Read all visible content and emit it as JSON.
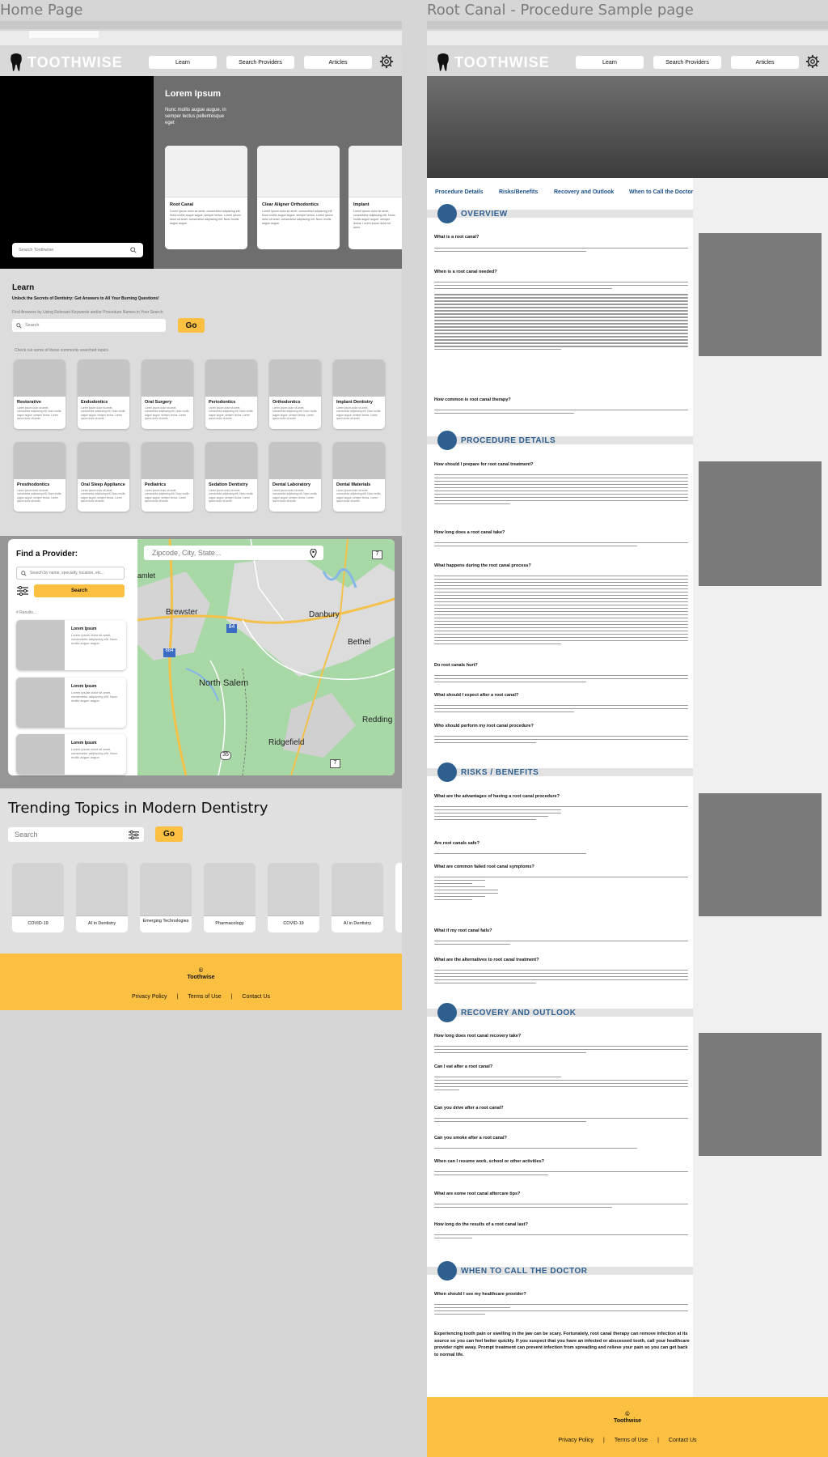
{
  "frames": {
    "home_title": "Home Page",
    "rc_title": "Root Canal - Procedure Sample page"
  },
  "brand": "TOOTHWISE",
  "nav": [
    "Learn",
    "Search Providers",
    "Articles"
  ],
  "home": {
    "hero": {
      "title": "Lorem Ipsum",
      "subtitle": "Nunc mollis augue augue, in semper lectus pellentesque eget",
      "search_placeholder": "Search Toothwise",
      "cards": [
        {
          "title": "Root Canal",
          "desc": "Lorem ipsum dolor sit amet, consectetur adipiscing elit. Nunc mollis augue augue, semper lectus. Lorem ipsum dolor sit amet, consectetur adipiscing elit. Nunc mollis augue augue."
        },
        {
          "title": "Clear Aligner Orthodontics",
          "desc": "Lorem ipsum dolor sit amet, consectetur adipiscing elit. Nunc mollis augue augue, semper lectus. Lorem ipsum dolor sit amet, consectetur adipiscing elit. Nunc mollis augue augue."
        },
        {
          "title": "Implant",
          "desc": "Lorem ipsum dolor sit amet, consectetur adipiscing elit. Nunc mollis augue augue, semper lectus. Lorem ipsum dolor sit amet."
        }
      ]
    },
    "learn": {
      "title": "Learn",
      "subtitle": "Unlock the Secrets of Dentistry: Get Answers to All Your Burning Questions!",
      "hint": "Find Answers by Using Relevant Keywords and/or Procedure Names in Your Search",
      "search_placeholder": "Search",
      "go": "Go",
      "common_label": "Check out some of these commonly searched topics",
      "topic_desc": "Lorem ipsum dolor sit amet, consectetur adipiscing elit. Nunc mollis augue augue, semper lectus. Lorem ipsum dolor sit amet.",
      "topics": [
        "Restorative",
        "Endodontics",
        "Oral Surgery",
        "Periodontics",
        "Orthodontics",
        "Implant Dentistry",
        "Prosthodontics",
        "Oral Sleep Appliance",
        "Pediatrics",
        "Sedation Dentistry",
        "Dental Laboratory",
        "Dental Materials"
      ]
    },
    "provider": {
      "title": "Find a Provider:",
      "search_placeholder": "Search by name, specialty, location, etc...",
      "search_btn": "Search",
      "results_label": "# Results...",
      "result_title": "Lorem Ipsum",
      "result_desc": "Lorem ipsum dolor sit amet, consectetur adipiscing elit. Nunc mollis augue augue.",
      "map_placeholder": "Zipcode, City, State...",
      "map_labels": [
        "amlet",
        "Brewster",
        "Danbury",
        "Bethel",
        "North Salem",
        "Redding",
        "Ridgefield"
      ],
      "route_labels": [
        "7",
        "84",
        "684",
        "35",
        "7"
      ]
    },
    "trending": {
      "title": "Trending Topics in Modern Dentistry",
      "search_placeholder": "Search",
      "go": "Go",
      "items": [
        "COVID-19",
        "AI in Dentistry",
        "Emerging Technologies",
        "Pharmacology",
        "COVID-19",
        "AI in Dentistry"
      ]
    },
    "footer": {
      "copyright": "©",
      "brand": "Toothwise",
      "links": [
        "Privacy Policy",
        "Terms of Use",
        "Contact Us"
      ],
      "sep": "|"
    }
  },
  "rc": {
    "tabs": [
      "Procedure Details",
      "Risks/Benefits",
      "Recovery and Outlook",
      "When to Call the Doctor"
    ],
    "sections": {
      "overview": {
        "title": "OVERVIEW",
        "questions": [
          "What is a root canal?",
          "When is a root canal needed?",
          "How common is root canal therapy?"
        ]
      },
      "procedure": {
        "title": "PROCEDURE DETAILS",
        "questions": [
          "How should I prepare for root canal treatment?",
          "How long does a root canal take?",
          "What happens during the root canal process?",
          "Do root canals hurt?",
          "What should I expect after a root canal?",
          "Who should perform my root canal procedure?"
        ]
      },
      "risks": {
        "title": "RISKS / BENEFITS",
        "questions": [
          "What are the advantages of having a root canal procedure?",
          "Are root canals safe?",
          "What are common failed root canal symptoms?",
          "What if my root canal fails?",
          "What are the alternatives to root canal treatment?"
        ]
      },
      "recovery": {
        "title": "RECOVERY AND OUTLOOK",
        "questions": [
          "How long does root canal recovery take?",
          "Can I eat after a root canal?",
          "Can you drive after a root canal?",
          "Can you smoke after a root canal?",
          "When can I resume work, school or other activities?",
          "What are some root canal aftercare tips?",
          "How long do the results of a root canal last?"
        ]
      },
      "doctor": {
        "title": "WHEN TO  CALL THE DOCTOR",
        "questions": [
          "When should I see my healthcare provider?"
        ],
        "closing": "Experiencing tooth pain or swelling in the jaw can be scary. Fortunately, root canal therapy can remove infection at its source so you can feel better quickly. If you suspect that you have an infected or abscessed tooth, call your healthcare provider right away. Prompt treatment can prevent infection from spreading and relieve your pain so you can get back to normal life."
      }
    }
  },
  "colors": {
    "accent": "#fbbf42",
    "section_blue": "#2e5f8f"
  },
  "icons": [
    "tooth-logo-icon",
    "gear-icon",
    "search-icon",
    "filter-icon",
    "location-pin-icon"
  ]
}
